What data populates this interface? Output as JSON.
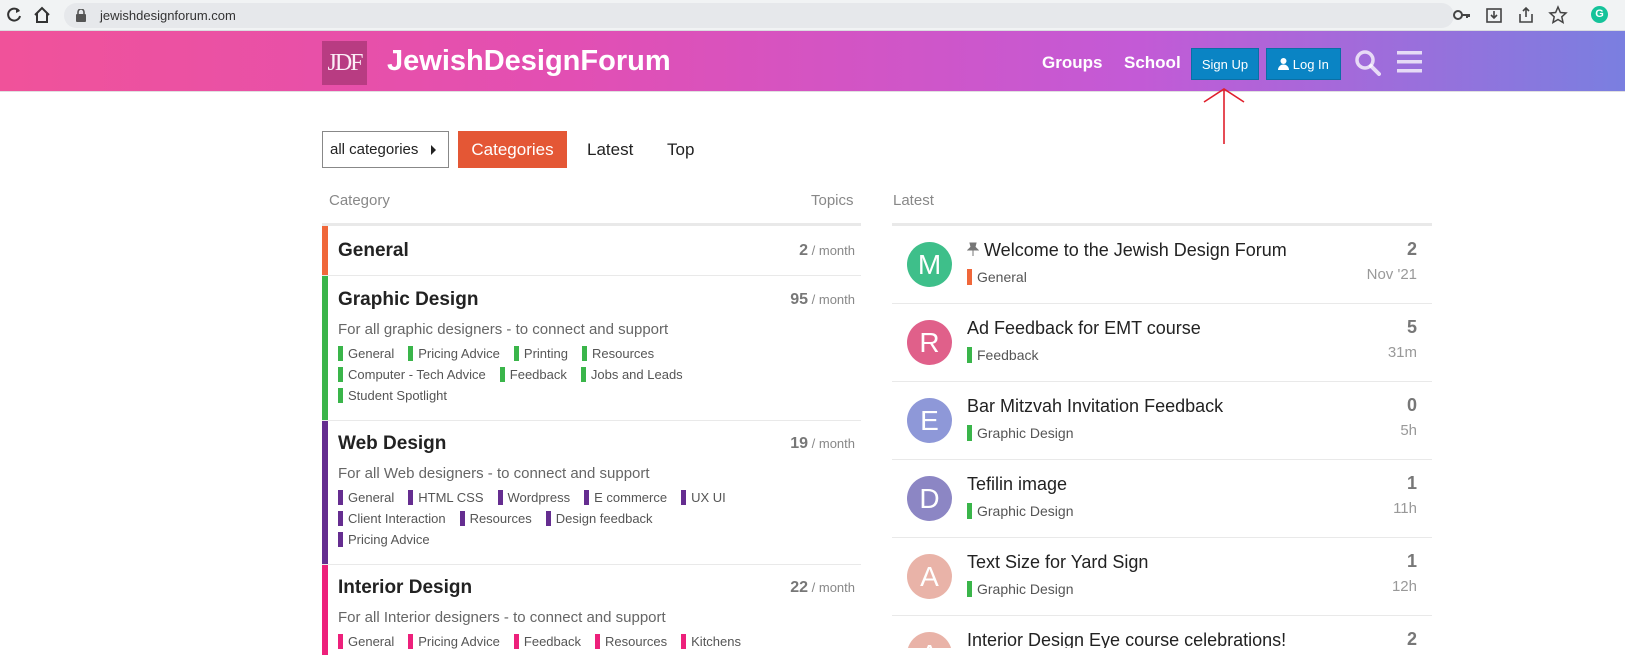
{
  "browser": {
    "url": "jewishdesignforum.com",
    "ext_letter": "G"
  },
  "header": {
    "logo_text": "JDF",
    "title": "JewishDesignForum",
    "links": [
      "Groups",
      "School"
    ],
    "signup_label": "Sign Up",
    "login_label": "Log In"
  },
  "nav": {
    "dropdown_label": "all categories",
    "tabs": [
      "Categories",
      "Latest",
      "Top"
    ]
  },
  "table": {
    "col_category": "Category",
    "col_topics": "Topics",
    "col_latest": "Latest"
  },
  "categories": [
    {
      "name": "General",
      "count": "2",
      "per": "/ month",
      "color": "#f0673a",
      "desc": "",
      "subs": []
    },
    {
      "name": "Graphic Design",
      "count": "95",
      "per": "/ month",
      "color": "#3ab54a",
      "desc": "For all graphic designers - to connect and support",
      "subs": [
        "General",
        "Pricing Advice",
        "Printing",
        "Resources",
        "Computer - Tech Advice",
        "Feedback",
        "Jobs and Leads",
        "Student Spotlight"
      ]
    },
    {
      "name": "Web Design",
      "count": "19",
      "per": "/ month",
      "color": "#652d90",
      "desc": "For all Web designers - to connect and support",
      "subs": [
        "General",
        "HTML CSS",
        "Wordpress",
        "E commerce",
        "UX UI",
        "Client Interaction",
        "Resources",
        "Design feedback",
        "Pricing Advice"
      ]
    },
    {
      "name": "Interior Design",
      "count": "22",
      "per": "/ month",
      "color": "#ed207b",
      "desc": "For all Interior designers - to connect and support",
      "subs": [
        "General",
        "Pricing Advice",
        "Feedback",
        "Resources",
        "Kitchens"
      ]
    }
  ],
  "latest": [
    {
      "avatar": "M",
      "avatar_color": "#3ebf8a",
      "pinned": true,
      "title": "Welcome to the Jewish Design Forum",
      "category": "General",
      "cat_color": "#f0673a",
      "count": "2",
      "age": "Nov '21"
    },
    {
      "avatar": "R",
      "avatar_color": "#e0608a",
      "pinned": false,
      "title": "Ad Feedback for EMT course",
      "category": "Feedback",
      "cat_color": "#3ab54a",
      "count": "5",
      "age": "31m"
    },
    {
      "avatar": "E",
      "avatar_color": "#8e98d8",
      "pinned": false,
      "title": "Bar Mitzvah Invitation Feedback",
      "category": "Graphic Design",
      "cat_color": "#3ab54a",
      "count": "0",
      "age": "5h"
    },
    {
      "avatar": "D",
      "avatar_color": "#8c86c4",
      "pinned": false,
      "title": "Tefilin image",
      "category": "Graphic Design",
      "cat_color": "#3ab54a",
      "count": "1",
      "age": "11h"
    },
    {
      "avatar": "A",
      "avatar_color": "#e9b3a8",
      "pinned": false,
      "title": "Text Size for Yard Sign",
      "category": "Graphic Design",
      "cat_color": "#3ab54a",
      "count": "1",
      "age": "12h"
    },
    {
      "avatar": "A",
      "avatar_color": "#e9b3a8",
      "pinned": false,
      "title": "Interior Design Eye course celebrations!",
      "category": "",
      "cat_color": "#ed207b",
      "count": "2",
      "age": ""
    }
  ]
}
